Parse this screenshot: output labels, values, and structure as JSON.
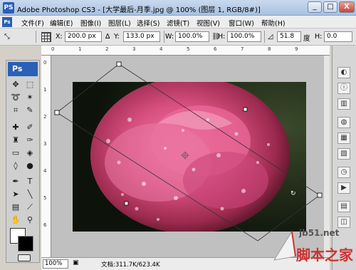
{
  "window": {
    "app_icon": "PS",
    "title": "Adobe Photoshop CS3 - [大学最后-月季.jpg @ 100% (图层 1, RGB/8#)]",
    "controls": [
      "_",
      "□",
      "X"
    ]
  },
  "menubar": {
    "items": [
      "文件(F)",
      "编辑(E)",
      "图像(I)",
      "图层(L)",
      "选择(S)",
      "滤镜(T)",
      "视图(V)",
      "窗口(W)",
      "帮助(H)"
    ]
  },
  "options": {
    "x_label": "X:",
    "x_value": "200.0 px",
    "y_label": "Y:",
    "y_value": "133.0 px",
    "w_label": "W:",
    "w_value": "100.0%",
    "h_label": "H:",
    "h_value": "100.0%",
    "angle_value": "51.8",
    "angle_unit": "度",
    "hskew_label": "H:",
    "hskew_value": "0.0"
  },
  "toolbox": {
    "header": "Ps"
  },
  "ruler": {
    "top_ticks": [
      "0",
      "1",
      "2",
      "3",
      "4",
      "5",
      "6",
      "7",
      "8",
      "9"
    ],
    "left_ticks": [
      "0",
      "1",
      "2",
      "3",
      "4",
      "5",
      "6"
    ]
  },
  "status": {
    "zoom": "100%",
    "doc_info": "文档:311.7K/623.4K"
  },
  "watermark": {
    "site": "jb51.net",
    "text": "脚本之家"
  },
  "colors": {
    "accent": "#2a60b5",
    "canvas_gray": "#c0c0c0"
  }
}
